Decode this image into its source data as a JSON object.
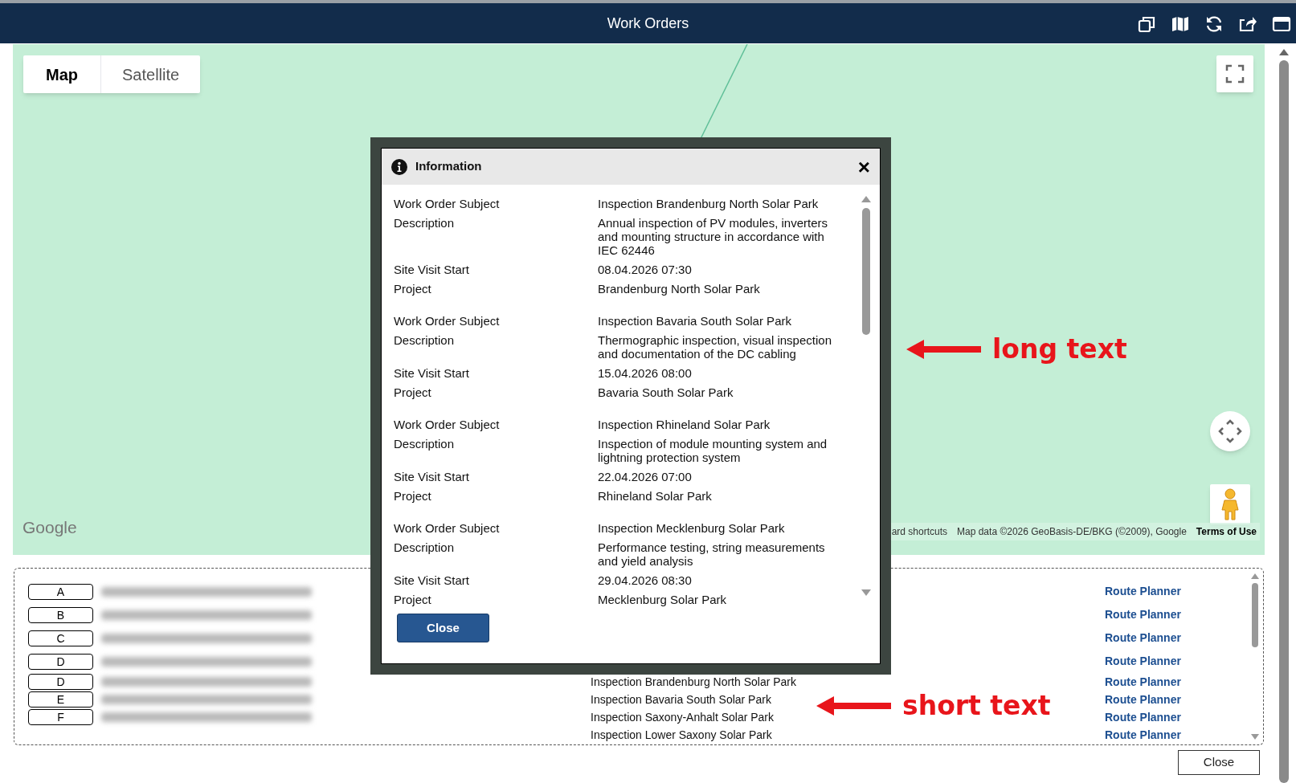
{
  "window": {
    "title": "Work Orders"
  },
  "map": {
    "tabs": [
      {
        "label": "Map",
        "selected": true
      },
      {
        "label": "Satellite",
        "selected": false
      }
    ],
    "logo": "Google",
    "attribution": [
      "ard shortcuts",
      "Map data ©2026 GeoBasis-DE/BKG (©2009), Google",
      "Terms of Use"
    ]
  },
  "dialog": {
    "title": "Information",
    "close_label": "×",
    "button": "Close",
    "entries": [
      {
        "subject": [
          "Work Order Subject",
          "Inspection Brandenburg North Solar Park"
        ],
        "description": [
          "Description",
          "Annual inspection of PV modules, inverters and mounting structure in accordance with IEC 62446"
        ],
        "start": [
          "Site Visit Start",
          "08.04.2026 07:30"
        ],
        "project": [
          "Project",
          "Brandenburg North Solar Park"
        ]
      },
      {
        "subject": [
          "Work Order Subject",
          "Inspection Bavaria South Solar Park"
        ],
        "description": [
          "Description",
          "Thermographic inspection, visual inspection and documentation of the DC cabling"
        ],
        "start": [
          "Site Visit Start",
          "15.04.2026 08:00"
        ],
        "project": [
          "Project",
          "Bavaria South Solar Park"
        ]
      },
      {
        "subject": [
          "Work Order Subject",
          "Inspection Rhineland Solar Park"
        ],
        "description": [
          "Description",
          "Inspection of module mounting system and lightning protection system"
        ],
        "start": [
          "Site Visit Start",
          "22.04.2026 07:00"
        ],
        "project": [
          "Project",
          "Rhineland Solar Park"
        ]
      },
      {
        "subject": [
          "Work Order Subject",
          "Inspection Mecklenburg Solar Park"
        ],
        "description": [
          "Description",
          "Performance testing, string measurements and yield analysis"
        ],
        "start": [
          "Site Visit Start",
          "29.04.2026 08:30"
        ],
        "project": [
          "Project",
          "Mecklenburg Solar Park"
        ]
      }
    ]
  },
  "list": {
    "rows": [
      {
        "letter": "A",
        "link": "Route Planner"
      },
      {
        "letter": "B",
        "link": "Route Planner"
      },
      {
        "letter": "C",
        "link": "Route Planner"
      },
      {
        "letter": "D",
        "link": "Route Planner"
      },
      {
        "letter": "D",
        "subject": "Inspection Brandenburg North Solar Park",
        "link": "Route Planner"
      },
      {
        "letter": "E",
        "subject": "Inspection Bavaria South Solar Park",
        "link": "Route Planner"
      },
      {
        "letter": "F",
        "subject": "Inspection Saxony-Anhalt Solar Park",
        "link": "Route Planner"
      },
      {
        "subject": "Inspection Lower Saxony Solar Park",
        "link": "Route Planner"
      }
    ]
  },
  "close_button": "Close",
  "annotations": [
    {
      "text": "long text"
    },
    {
      "text": "short text"
    }
  ]
}
